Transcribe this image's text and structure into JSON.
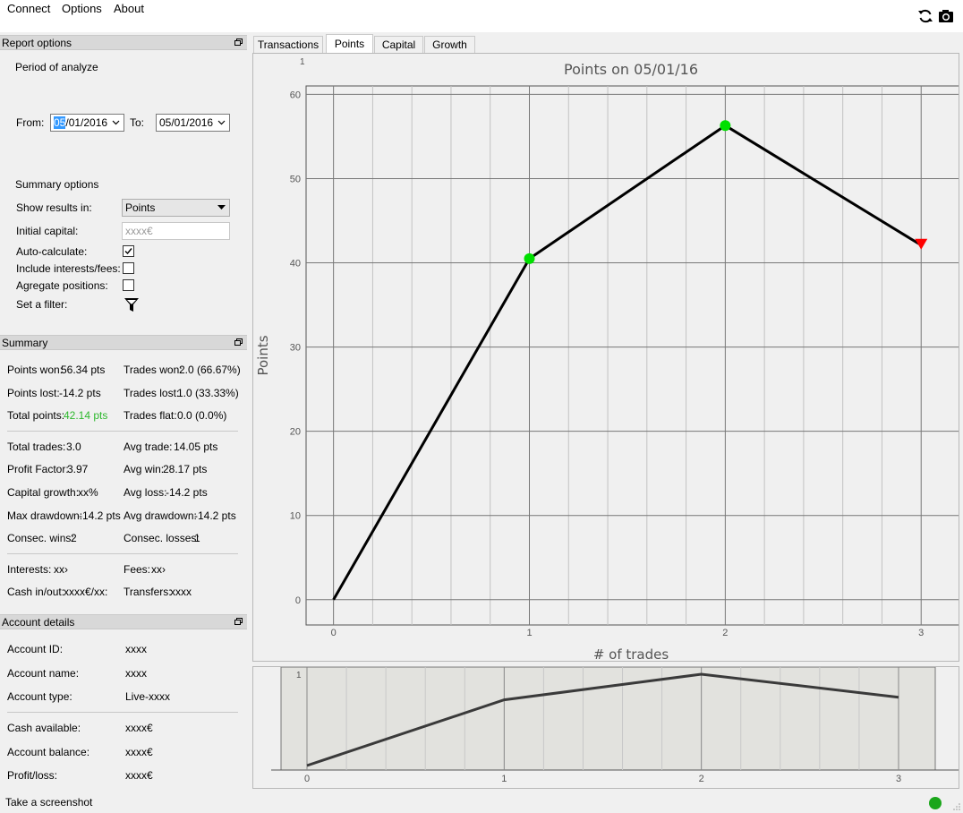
{
  "menu": {
    "items": [
      "Connect",
      "Options",
      "About"
    ]
  },
  "toolbar": {
    "refresh_icon": "refresh-icon",
    "camera_icon": "camera-icon"
  },
  "report_options": {
    "header": "Report options",
    "period_label": "Period of analyze",
    "from_label": "From:",
    "from_value_highlight": "05",
    "from_value_rest": "/01/2016",
    "to_label": "To:",
    "to_value": "05/01/2016",
    "summary_options_label": "Summary options",
    "show_results_label": "Show results in:",
    "show_results_value": "Points",
    "initial_capital_label": "Initial capital:",
    "initial_capital_placeholder": "xxxx€",
    "auto_calculate_label": "Auto-calculate:",
    "auto_calculate_checked": true,
    "include_interests_label": "Include interests/fees:",
    "include_interests_checked": false,
    "agregate_label": "Agregate positions:",
    "agregate_checked": false,
    "filter_label": "Set a filter:"
  },
  "summary": {
    "header": "Summary",
    "points_won_label": "Points won:",
    "points_won": "56.34 pts",
    "trades_won_label": "Trades won:",
    "trades_won": "2.0 (66.67%)",
    "points_lost_label": "Points lost:",
    "points_lost": "-14.2 pts",
    "trades_lost_label": "Trades lost:",
    "trades_lost": "1.0 (33.33%)",
    "total_points_label": "Total points:",
    "total_points": "42.14 pts",
    "trades_flat_label": "Trades flat:",
    "trades_flat": "0.0 (0.0%)",
    "total_trades_label": "Total trades:",
    "total_trades": "3.0",
    "avg_trade_label": "Avg trade:",
    "avg_trade": "14.05 pts",
    "profit_factor_label": "Profit Factor:",
    "profit_factor": "3.97",
    "avg_win_label": "Avg win:",
    "avg_win": "28.17 pts",
    "capital_growth_label": "Capital growth:",
    "capital_growth": "xx%",
    "avg_loss_label": "Avg loss:",
    "avg_loss": "-14.2 pts",
    "max_drawdown_label": "Max drawdown:",
    "max_drawdown": "-14.2 pts",
    "avg_drawdown_label": "Avg drawdown:",
    "avg_drawdown": "-14.2 pts",
    "consec_wins_label": "Consec. wins:",
    "consec_wins": "2",
    "consec_losses_label": "Consec. losses:",
    "consec_losses": "1",
    "interests_label": "Interests:",
    "interests": "xx›",
    "fees_label": "Fees:",
    "fees": "xx›",
    "cash_inout_label": "Cash in/out:",
    "cash_inout": "xxxx€/xx:",
    "transfers_label": "Transfers:",
    "transfers": "xxxx",
    "total_points_color": "#2eb82e"
  },
  "account": {
    "header": "Account details",
    "id_label": "Account ID:",
    "id": "xxxx",
    "name_label": "Account name:",
    "name": "xxxx",
    "type_label": "Account type:",
    "type": "Live-xxxx",
    "cash_label": "Cash available:",
    "cash": "xxxx€",
    "balance_label": "Account balance:",
    "balance": "xxxx€",
    "pl_label": "Profit/loss:",
    "pl": "xxxx€"
  },
  "tabs": [
    "Transactions",
    "Points",
    "Capital",
    "Growth"
  ],
  "active_tab": "Points",
  "status": {
    "text": "Take a screenshot",
    "indicator_color": "#1aa61a"
  },
  "chart_data": {
    "type": "line",
    "title": "Points on 05/01/16",
    "xlabel": "# of trades",
    "ylabel": "Points",
    "x": [
      0,
      1,
      2,
      3
    ],
    "y": [
      0,
      40.5,
      56.3,
      42.1
    ],
    "xlim": [
      -0.14,
      3.2
    ],
    "ylim": [
      -3,
      61
    ],
    "xticks": [
      "0",
      "1",
      "2",
      "3"
    ],
    "yticks": [
      "0",
      "10",
      "20",
      "30",
      "40",
      "50",
      "60"
    ],
    "top_tick_label": "1",
    "marker_colors": {
      "up": "#00e000",
      "down": "#ff0000"
    },
    "line_color": "#000000",
    "grid": true
  },
  "overview_chart": {
    "xticks": [
      "0",
      "1",
      "2",
      "3"
    ],
    "top_tick_label": "1"
  }
}
